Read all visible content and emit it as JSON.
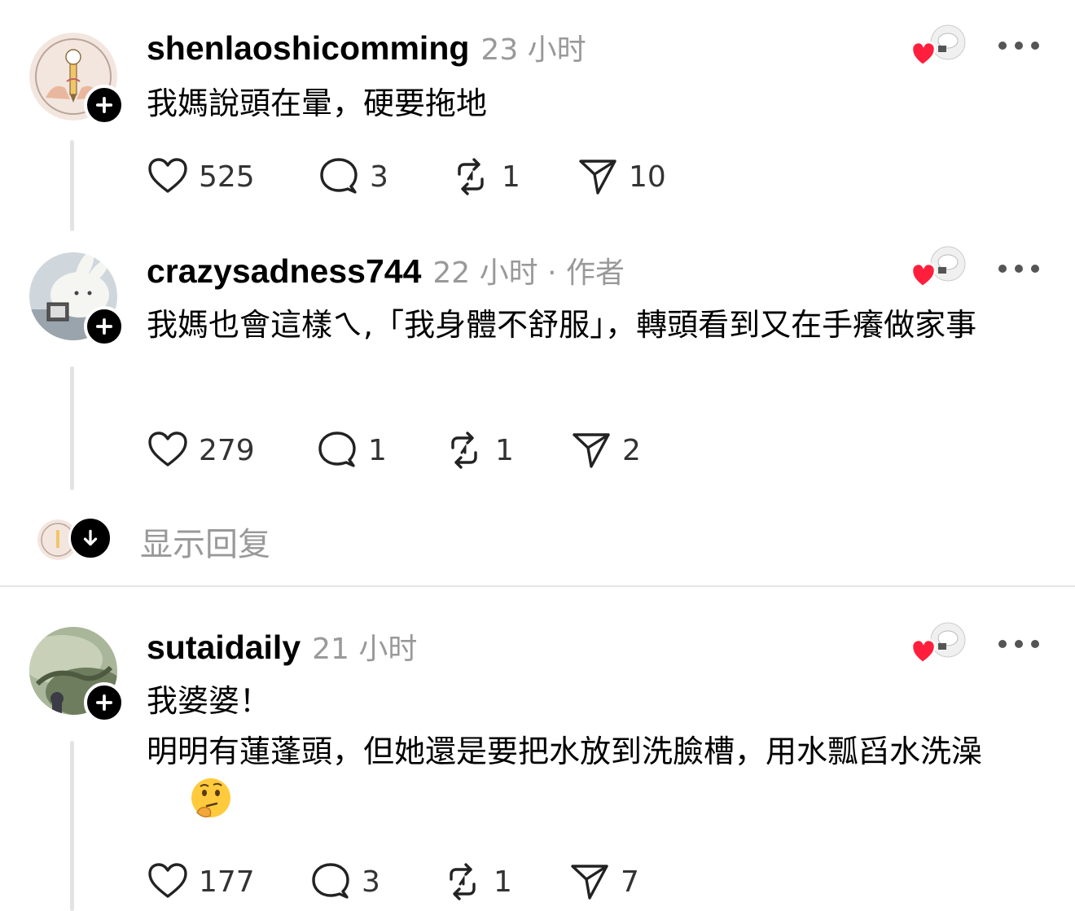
{
  "posts": [
    {
      "username": "shenlaoshicomming",
      "time": "23 小时",
      "author_tag": "",
      "body": [
        "我媽說頭在暈，硬要拖地"
      ],
      "likes": "525",
      "comments": "3",
      "reposts": "1",
      "shares": "10",
      "avatar": "justice-for-kaikai-logo"
    },
    {
      "username": "crazysadness744",
      "time": "22 小时",
      "author_tag": " · 作者",
      "body": [
        "我媽也會這樣ㄟ,「我身體不舒服」，轉頭看到又在手癢做家事"
      ],
      "likes": "279",
      "comments": "1",
      "reposts": "1",
      "shares": "2",
      "avatar": "white-rabbit-photo"
    },
    {
      "username": "sutaidaily",
      "time": "21 小时",
      "author_tag": "",
      "body": [
        "我婆婆！",
        "明明有蓮蓬頭，但她還是要把水放到洗臉槽，用水瓢舀水洗澡"
      ],
      "emoji": "thinking-face",
      "likes": "177",
      "comments": "3",
      "reposts": "1",
      "shares": "7",
      "avatar": "green-landscape-photo"
    }
  ],
  "show_replies": "显示回复",
  "colors": {
    "text": "#000000",
    "meta": "#999999",
    "like_heart": "#ff1f3d",
    "thread_line": "#e3e3e3"
  },
  "icons": [
    "heart-icon",
    "comment-icon",
    "repost-icon",
    "share-icon",
    "more-icon",
    "plus-icon",
    "arrow-down-icon"
  ]
}
